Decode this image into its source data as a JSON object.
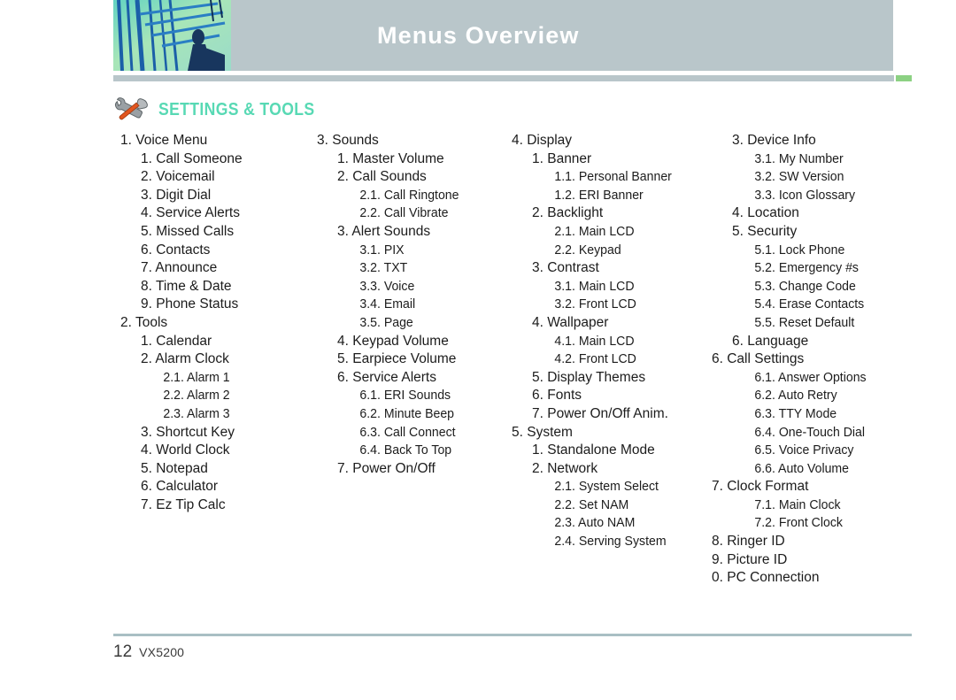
{
  "header": {
    "title": "Menus Overview",
    "photo_icon": "abstract-blue-green-photo",
    "accent_color": "#8cd183",
    "band_color": "#b9c6ca"
  },
  "section": {
    "icon": "wrench-hammer-icon",
    "label": "SETTINGS & TOOLS",
    "color": "#58d9b4"
  },
  "footer": {
    "page_number": "12",
    "model": "VX5200",
    "rule_color": "#a9bfc4"
  },
  "menu_columns": [
    {
      "name": "column-1",
      "items": [
        {
          "level": 1,
          "text": "1. Voice Menu"
        },
        {
          "level": 2,
          "text": "1. Call Someone"
        },
        {
          "level": 2,
          "text": "2. Voicemail"
        },
        {
          "level": 2,
          "text": "3. Digit Dial"
        },
        {
          "level": 2,
          "text": "4. Service Alerts"
        },
        {
          "level": 2,
          "text": "5. Missed Calls"
        },
        {
          "level": 2,
          "text": "6. Contacts"
        },
        {
          "level": 2,
          "text": "7. Announce"
        },
        {
          "level": 2,
          "text": "8. Time & Date"
        },
        {
          "level": 2,
          "text": "9. Phone Status"
        },
        {
          "level": 1,
          "text": "2. Tools"
        },
        {
          "level": 2,
          "text": "1. Calendar"
        },
        {
          "level": 2,
          "text": "2. Alarm Clock"
        },
        {
          "level": 3,
          "text": "2.1. Alarm 1"
        },
        {
          "level": 3,
          "text": "2.2. Alarm 2"
        },
        {
          "level": 3,
          "text": "2.3. Alarm 3"
        },
        {
          "level": 2,
          "text": "3. Shortcut Key"
        },
        {
          "level": 2,
          "text": "4. World Clock"
        },
        {
          "level": 2,
          "text": "5. Notepad"
        },
        {
          "level": 2,
          "text": "6. Calculator"
        },
        {
          "level": 2,
          "text": "7. Ez Tip Calc"
        }
      ]
    },
    {
      "name": "column-2",
      "items": [
        {
          "level": 1,
          "text": "3. Sounds"
        },
        {
          "level": 2,
          "text": "1. Master Volume"
        },
        {
          "level": 2,
          "text": "2. Call Sounds"
        },
        {
          "level": 3,
          "text": "2.1. Call Ringtone"
        },
        {
          "level": 3,
          "text": "2.2. Call Vibrate"
        },
        {
          "level": 2,
          "text": "3. Alert Sounds"
        },
        {
          "level": 3,
          "text": "3.1. PIX"
        },
        {
          "level": 3,
          "text": "3.2. TXT"
        },
        {
          "level": 3,
          "text": "3.3. Voice"
        },
        {
          "level": 3,
          "text": "3.4. Email"
        },
        {
          "level": 3,
          "text": "3.5. Page"
        },
        {
          "level": 2,
          "text": "4. Keypad Volume"
        },
        {
          "level": 2,
          "text": "5. Earpiece Volume"
        },
        {
          "level": 2,
          "text": "6. Service Alerts"
        },
        {
          "level": 3,
          "text": "6.1. ERI Sounds"
        },
        {
          "level": 3,
          "text": "6.2. Minute Beep"
        },
        {
          "level": 3,
          "text": "6.3. Call Connect"
        },
        {
          "level": 3,
          "text": "6.4. Back To Top"
        },
        {
          "level": 2,
          "text": "7. Power On/Off"
        }
      ]
    },
    {
      "name": "column-3",
      "items": [
        {
          "level": 1,
          "text": "4. Display"
        },
        {
          "level": 2,
          "text": "1. Banner"
        },
        {
          "level": 3,
          "text": "1.1. Personal Banner"
        },
        {
          "level": 3,
          "text": "1.2. ERI Banner"
        },
        {
          "level": 2,
          "text": "2. Backlight"
        },
        {
          "level": 3,
          "text": "2.1. Main LCD"
        },
        {
          "level": 3,
          "text": "2.2. Keypad"
        },
        {
          "level": 2,
          "text": "3. Contrast"
        },
        {
          "level": 3,
          "text": "3.1. Main LCD"
        },
        {
          "level": 3,
          "text": "3.2. Front LCD"
        },
        {
          "level": 2,
          "text": "4. Wallpaper"
        },
        {
          "level": 3,
          "text": "4.1. Main LCD"
        },
        {
          "level": 3,
          "text": "4.2. Front LCD"
        },
        {
          "level": 2,
          "text": "5. Display Themes"
        },
        {
          "level": 2,
          "text": "6. Fonts"
        },
        {
          "level": 2,
          "text": "7. Power On/Off Anim."
        },
        {
          "level": 1,
          "text": "5. System"
        },
        {
          "level": 2,
          "text": "1. Standalone Mode"
        },
        {
          "level": 2,
          "text": "2. Network"
        },
        {
          "level": 3,
          "text": "2.1. System Select"
        },
        {
          "level": 3,
          "text": "2.2. Set NAM"
        },
        {
          "level": 3,
          "text": "2.3. Auto NAM"
        },
        {
          "level": 3,
          "text": "2.4. Serving System"
        }
      ]
    },
    {
      "name": "column-4",
      "items": [
        {
          "level": 2,
          "text": "3. Device Info"
        },
        {
          "level": 3,
          "text": "3.1. My Number"
        },
        {
          "level": 3,
          "text": "3.2. SW Version"
        },
        {
          "level": 3,
          "text": "3.3. Icon Glossary"
        },
        {
          "level": 2,
          "text": "4. Location"
        },
        {
          "level": 2,
          "text": "5. Security"
        },
        {
          "level": 3,
          "text": "5.1. Lock Phone"
        },
        {
          "level": 3,
          "text": "5.2. Emergency #s"
        },
        {
          "level": 3,
          "text": "5.3. Change Code"
        },
        {
          "level": 3,
          "text": "5.4. Erase Contacts"
        },
        {
          "level": 3,
          "text": "5.5. Reset Default"
        },
        {
          "level": 2,
          "text": "6. Language"
        },
        {
          "level": 1,
          "text": "6. Call Settings"
        },
        {
          "level": 3,
          "text": "6.1. Answer Options"
        },
        {
          "level": 3,
          "text": "6.2. Auto Retry"
        },
        {
          "level": 3,
          "text": "6.3. TTY Mode"
        },
        {
          "level": 3,
          "text": "6.4. One-Touch Dial"
        },
        {
          "level": 3,
          "text": "6.5. Voice Privacy"
        },
        {
          "level": 3,
          "text": "6.6. Auto Volume"
        },
        {
          "level": 1,
          "text": "7. Clock Format"
        },
        {
          "level": 3,
          "text": "7.1. Main Clock"
        },
        {
          "level": 3,
          "text": "7.2. Front Clock"
        },
        {
          "level": 1,
          "text": "8. Ringer ID"
        },
        {
          "level": 1,
          "text": "9. Picture ID"
        },
        {
          "level": 1,
          "text": "0. PC Connection"
        }
      ]
    }
  ]
}
